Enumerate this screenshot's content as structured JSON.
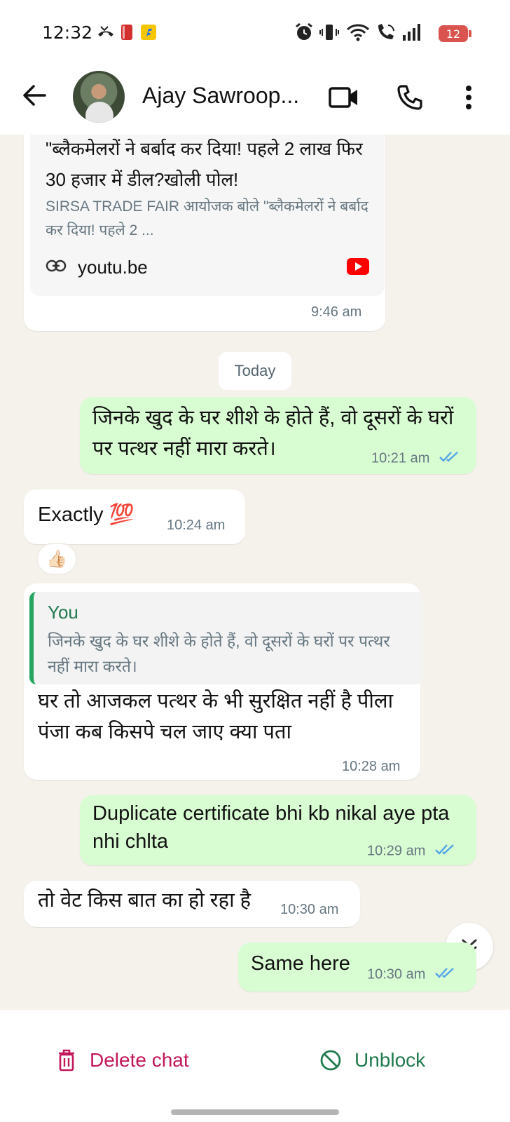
{
  "status": {
    "time": "12:32",
    "battery": "12",
    "icons": [
      "missed-call-icon",
      "red-app-icon",
      "flipkart-icon",
      "alarm-icon",
      "vibrate-icon",
      "wifi-icon",
      "wifi-calling-icon",
      "signal-icon",
      "battery-icon"
    ]
  },
  "header": {
    "contact_name": "Ajay Sawroop...",
    "icons": [
      "back-arrow-icon",
      "video-call-icon",
      "phone-icon",
      "more-vert-icon"
    ]
  },
  "messages": [
    {
      "id": "m0",
      "direction": "in",
      "link_preview": {
        "title": "\"ब्लैकमेलरों ने बर्बाद कर दिया! पहले 2 लाख फिर 30 हजार में डील?खोली पोल!",
        "description": "SIRSA TRADE FAIR आयोजक बोले \"ब्लैकमेलरों ने बर्बाद कर दिया! पहले 2 ...",
        "domain": "youtu.be"
      },
      "time": "9:46 am"
    },
    {
      "id": "date",
      "label": "Today"
    },
    {
      "id": "m1",
      "direction": "out",
      "text": "जिनके खुद के घर शीशे के होते हैं, वो दूसरों के घरों पर पत्थर नहीं मारा करते।",
      "time": "10:21 am",
      "status": "read"
    },
    {
      "id": "m2",
      "direction": "in",
      "text": "Exactly 💯",
      "time": "10:24 am",
      "reaction": "👍🏻"
    },
    {
      "id": "m3",
      "direction": "in",
      "quote": {
        "author": "You",
        "text": "जिनके खुद के घर शीशे के होते हैं, वो दूसरों के घरों पर पत्थर नहीं मारा करते।"
      },
      "text": "घर तो आजकल पत्थर के भी सुरक्षित नहीं है पीला पंजा कब किसपे चल जाए क्या पता",
      "time": "10:28 am"
    },
    {
      "id": "m4",
      "direction": "out",
      "text": "Duplicate certificate bhi kb nikal aye pta nhi chlta",
      "time": "10:29 am",
      "status": "read"
    },
    {
      "id": "m5",
      "direction": "in",
      "text": "तो वेट किस बात का हो रहा है",
      "time": "10:30 am"
    },
    {
      "id": "m6",
      "direction": "out",
      "text": "Same here",
      "time": "10:30 am",
      "status": "read"
    }
  ],
  "bottom": {
    "delete_label": "Delete chat",
    "unblock_label": "Unblock"
  },
  "colors": {
    "outgoing_bubble": "#d9fdd3",
    "incoming_bubble": "#ffffff",
    "chat_bg": "#f5f2ec",
    "delete": "#c2185b",
    "unblock": "#1f7a4d",
    "read_ticks": "#53a6e8"
  }
}
